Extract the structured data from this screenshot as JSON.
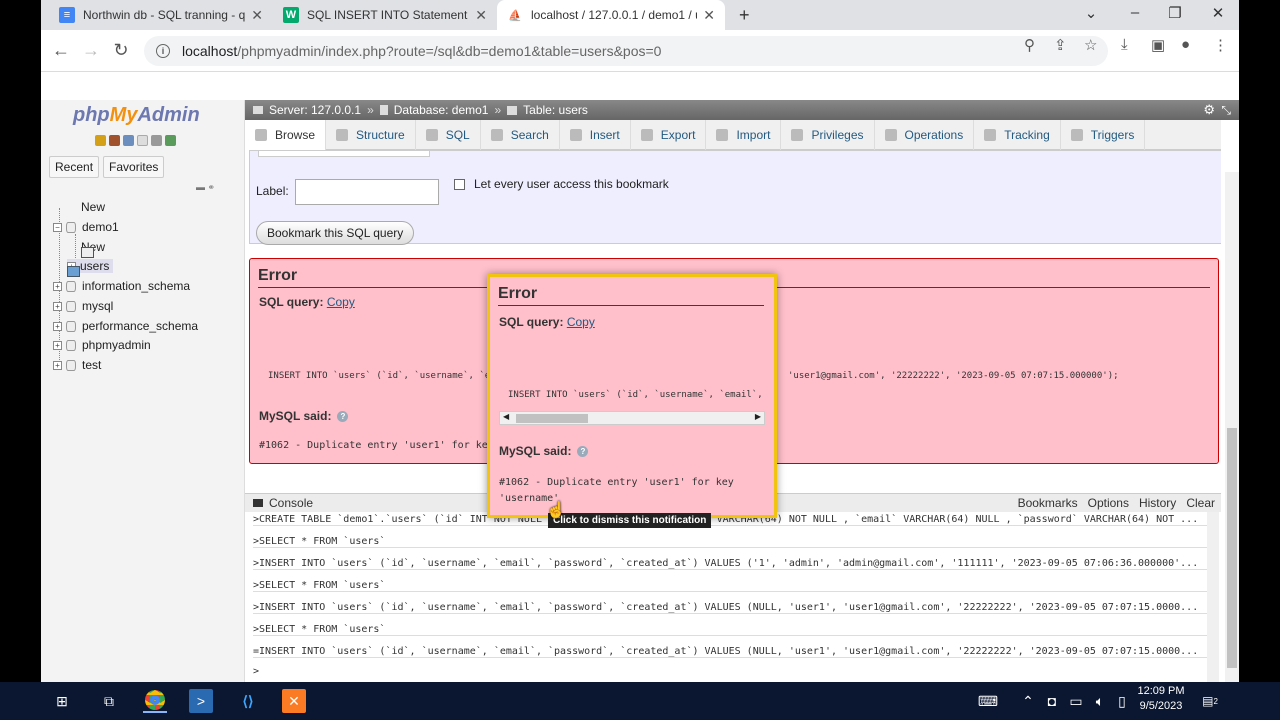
{
  "browser": {
    "tabs": [
      {
        "label": "Northwin db - SQL tranning - qu",
        "icon": "docs-icon",
        "active": false
      },
      {
        "label": "SQL INSERT INTO Statement",
        "icon": "w3schools-icon",
        "active": false
      },
      {
        "label": "localhost / 127.0.0.1 / demo1 / u",
        "icon": "phpmyadmin-icon",
        "active": true
      }
    ],
    "new_tab": "+",
    "url_host": "localhost",
    "url_path": "/phpmyadmin/index.php?route=/sql&db=demo1&table=users&pos=0"
  },
  "pma": {
    "logo": {
      "php": "php",
      "my": "My",
      "admin": "Admin"
    },
    "nav_tabs": [
      "Recent",
      "Favorites"
    ],
    "tree": {
      "new_label": "New",
      "db": "demo1",
      "db_new": "New",
      "table": "users",
      "others": [
        "information_schema",
        "mysql",
        "performance_schema",
        "phpmyadmin",
        "test"
      ]
    },
    "breadcrumb": {
      "server": "Server: 127.0.0.1",
      "database": "Database: demo1",
      "table": "Table: users",
      "sep": "»"
    },
    "tabs": [
      "Browse",
      "Structure",
      "SQL",
      "Search",
      "Insert",
      "Export",
      "Import",
      "Privileges",
      "Operations",
      "Tracking",
      "Triggers"
    ],
    "bookmark": {
      "label": "Label:",
      "checkbox_label": "Let every user access this bookmark",
      "button": "Bookmark this SQL query"
    },
    "error": {
      "title": "Error",
      "sql_query_label": "SQL query:",
      "copy": "Copy",
      "query_left": "INSERT INTO `users` (`id`, `username`, `e",
      "query_right": "'user1@gmail.com', '22222222', '2023-09-05 07:07:15.000000');",
      "mysql_said": "MySQL said:",
      "message_left": "#1062 - Duplicate entry 'user1' for ke"
    },
    "popup": {
      "title": "Error",
      "sql_query_label": "SQL query:",
      "copy": "Copy",
      "query": "INSERT INTO `users` (`id`, `username`, `email`,",
      "mysql_said": "MySQL said:",
      "message": "#1062 - Duplicate entry 'user1' for key 'username'",
      "tooltip": "Click to dismiss this notification"
    },
    "console": {
      "title": "Console",
      "links": [
        "Bookmarks",
        "Options",
        "History",
        "Clear"
      ],
      "lines": [
        ">CREATE TABLE `demo1`.`users` (`id` INT NOT NULL AUTO_INCREMENT , `username` VARCHAR(64) NOT NULL , `email` VARCHAR(64) NULL , `password` VARCHAR(64) NOT ...",
        ">SELECT * FROM `users`",
        ">INSERT INTO `users` (`id`, `username`, `email`, `password`, `created_at`) VALUES ('1', 'admin', 'admin@gmail.com', '111111', '2023-09-05 07:06:36.000000'...",
        ">SELECT * FROM `users`",
        ">INSERT INTO `users` (`id`, `username`, `email`, `password`, `created_at`) VALUES (NULL, 'user1', 'user1@gmail.com', '22222222', '2023-09-05 07:07:15.0000...",
        ">SELECT * FROM `users`",
        "=INSERT INTO `users` (`id`, `username`, `email`, `password`, `created_at`) VALUES (NULL, 'user1', 'user1@gmail.com', '22222222', '2023-09-05 07:07:15.0000...",
        ">"
      ]
    }
  },
  "taskbar": {
    "time": "12:09 PM",
    "date": "9/5/2023",
    "notification_count": "2"
  },
  "colors": {
    "error_bg": "#ffc0cb",
    "popup_border": "#f1c40f",
    "taskbar": "#0b1730",
    "link": "#235a81"
  }
}
